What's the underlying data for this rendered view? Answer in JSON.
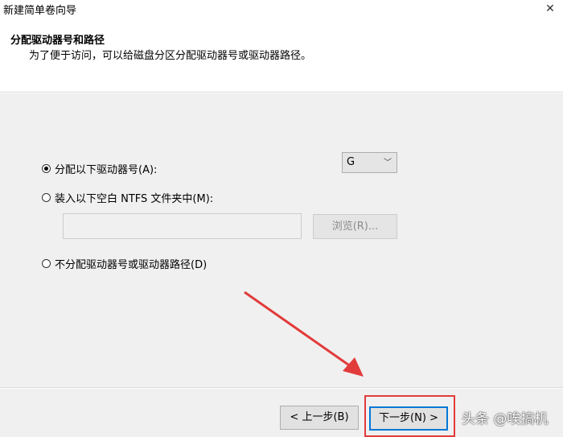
{
  "window": {
    "title": "新建简单卷向导"
  },
  "header": {
    "title": "分配驱动器号和路径",
    "subtitle": "为了便于访问，可以给磁盘分区分配驱动器号或驱动器路径。"
  },
  "options": {
    "assign_letter": {
      "label": "分配以下驱动器号(A):",
      "checked": true
    },
    "mount_folder": {
      "label": "装入以下空白 NTFS 文件夹中(M):",
      "checked": false
    },
    "no_assign": {
      "label": "不分配驱动器号或驱动器路径(D)",
      "checked": false
    }
  },
  "drive_letter": {
    "selected": "G"
  },
  "folder_path": {
    "value": ""
  },
  "buttons": {
    "browse": "浏览(R)...",
    "back": "< 上一步(B)",
    "next": "下一步(N) >"
  },
  "watermark": {
    "text": "头条 @唉搞机"
  },
  "colors": {
    "annotation": "#e23b3b",
    "focus": "#0078d7"
  }
}
